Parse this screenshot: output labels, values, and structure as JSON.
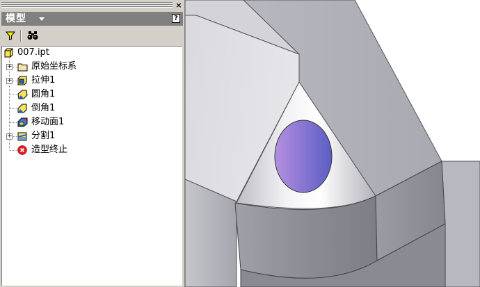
{
  "panel": {
    "title": "模型",
    "close_glyph": "×",
    "help_glyph": "?",
    "toolbar": {
      "filter_icon": "funnel-icon",
      "find_icon": "binoculars-icon"
    }
  },
  "tree": {
    "root": {
      "label": "007.ipt",
      "icon": "part-icon"
    },
    "items": [
      {
        "label": "原始坐标系",
        "icon": "folder-icon",
        "expandable": true
      },
      {
        "label": "拉伸1",
        "icon": "extrude-icon",
        "expandable": true
      },
      {
        "label": "圆角1",
        "icon": "fillet-icon",
        "expandable": false
      },
      {
        "label": "倒角1",
        "icon": "chamfer-icon",
        "expandable": false
      },
      {
        "label": "移动面1",
        "icon": "move-face-icon",
        "expandable": false
      },
      {
        "label": "分割1",
        "icon": "split-icon",
        "expandable": true
      },
      {
        "label": "造型终止",
        "icon": "end-of-part-icon",
        "expandable": false
      }
    ]
  },
  "colors": {
    "panel_bg": "#d4d0c8",
    "title_bg": "#808080",
    "end_of_part": "#e31e24",
    "ellipse_light": "#b68fe0",
    "ellipse_dark": "#5b5ec4"
  }
}
